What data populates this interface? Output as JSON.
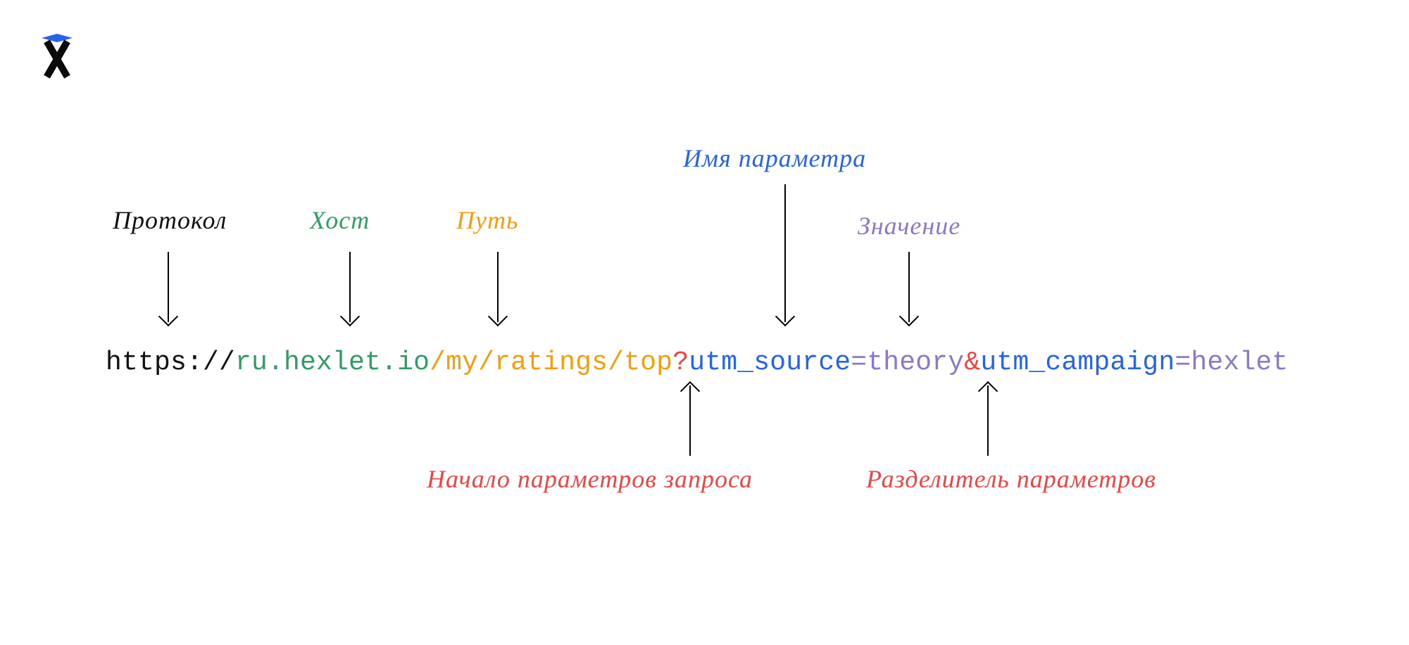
{
  "labels": {
    "protocol": "Протокол",
    "host": "Хост",
    "path": "Путь",
    "param_name": "Имя параметра",
    "value": "Значение",
    "query_start": "Начало параметров запроса",
    "param_separator": "Разделитель параметров"
  },
  "url": {
    "protocol": "https://",
    "host": "ru.hexlet.io",
    "slash1": "/",
    "path1": "my",
    "slash2": "/",
    "path2": "ratings",
    "slash3": "/",
    "path3": "top",
    "qmark": "?",
    "param1_name": "utm_source",
    "eq1": "=",
    "param1_value": "theory",
    "amp": "&",
    "param2_name": "utm_campaign",
    "eq2": "=",
    "param2_value": "hexlet"
  }
}
